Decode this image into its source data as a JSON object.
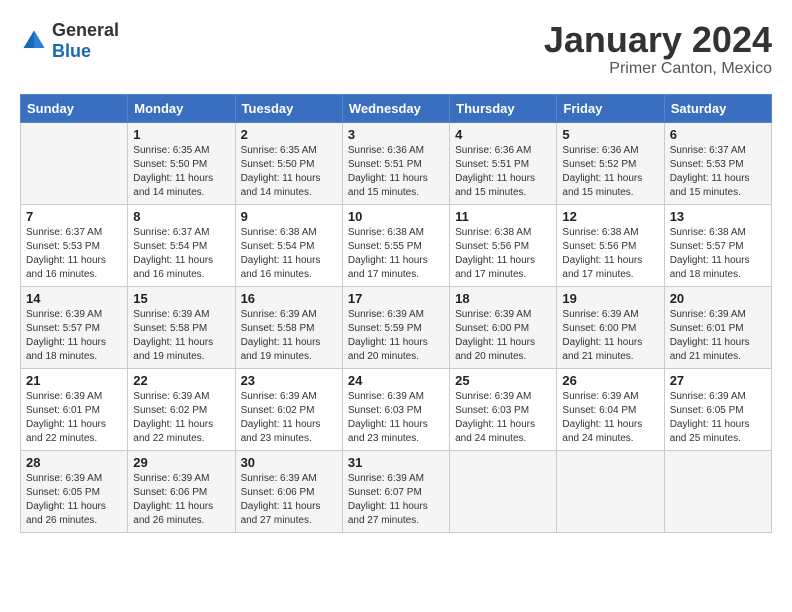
{
  "header": {
    "logo": {
      "general": "General",
      "blue": "Blue"
    },
    "title": "January 2024",
    "location": "Primer Canton, Mexico"
  },
  "calendar": {
    "days_of_week": [
      "Sunday",
      "Monday",
      "Tuesday",
      "Wednesday",
      "Thursday",
      "Friday",
      "Saturday"
    ],
    "weeks": [
      [
        {
          "day": "",
          "sunrise": "",
          "sunset": "",
          "daylight": ""
        },
        {
          "day": "1",
          "sunrise": "Sunrise: 6:35 AM",
          "sunset": "Sunset: 5:50 PM",
          "daylight": "Daylight: 11 hours and 14 minutes."
        },
        {
          "day": "2",
          "sunrise": "Sunrise: 6:35 AM",
          "sunset": "Sunset: 5:50 PM",
          "daylight": "Daylight: 11 hours and 14 minutes."
        },
        {
          "day": "3",
          "sunrise": "Sunrise: 6:36 AM",
          "sunset": "Sunset: 5:51 PM",
          "daylight": "Daylight: 11 hours and 15 minutes."
        },
        {
          "day": "4",
          "sunrise": "Sunrise: 6:36 AM",
          "sunset": "Sunset: 5:51 PM",
          "daylight": "Daylight: 11 hours and 15 minutes."
        },
        {
          "day": "5",
          "sunrise": "Sunrise: 6:36 AM",
          "sunset": "Sunset: 5:52 PM",
          "daylight": "Daylight: 11 hours and 15 minutes."
        },
        {
          "day": "6",
          "sunrise": "Sunrise: 6:37 AM",
          "sunset": "Sunset: 5:53 PM",
          "daylight": "Daylight: 11 hours and 15 minutes."
        }
      ],
      [
        {
          "day": "7",
          "sunrise": "Sunrise: 6:37 AM",
          "sunset": "Sunset: 5:53 PM",
          "daylight": "Daylight: 11 hours and 16 minutes."
        },
        {
          "day": "8",
          "sunrise": "Sunrise: 6:37 AM",
          "sunset": "Sunset: 5:54 PM",
          "daylight": "Daylight: 11 hours and 16 minutes."
        },
        {
          "day": "9",
          "sunrise": "Sunrise: 6:38 AM",
          "sunset": "Sunset: 5:54 PM",
          "daylight": "Daylight: 11 hours and 16 minutes."
        },
        {
          "day": "10",
          "sunrise": "Sunrise: 6:38 AM",
          "sunset": "Sunset: 5:55 PM",
          "daylight": "Daylight: 11 hours and 17 minutes."
        },
        {
          "day": "11",
          "sunrise": "Sunrise: 6:38 AM",
          "sunset": "Sunset: 5:56 PM",
          "daylight": "Daylight: 11 hours and 17 minutes."
        },
        {
          "day": "12",
          "sunrise": "Sunrise: 6:38 AM",
          "sunset": "Sunset: 5:56 PM",
          "daylight": "Daylight: 11 hours and 17 minutes."
        },
        {
          "day": "13",
          "sunrise": "Sunrise: 6:38 AM",
          "sunset": "Sunset: 5:57 PM",
          "daylight": "Daylight: 11 hours and 18 minutes."
        }
      ],
      [
        {
          "day": "14",
          "sunrise": "Sunrise: 6:39 AM",
          "sunset": "Sunset: 5:57 PM",
          "daylight": "Daylight: 11 hours and 18 minutes."
        },
        {
          "day": "15",
          "sunrise": "Sunrise: 6:39 AM",
          "sunset": "Sunset: 5:58 PM",
          "daylight": "Daylight: 11 hours and 19 minutes."
        },
        {
          "day": "16",
          "sunrise": "Sunrise: 6:39 AM",
          "sunset": "Sunset: 5:58 PM",
          "daylight": "Daylight: 11 hours and 19 minutes."
        },
        {
          "day": "17",
          "sunrise": "Sunrise: 6:39 AM",
          "sunset": "Sunset: 5:59 PM",
          "daylight": "Daylight: 11 hours and 20 minutes."
        },
        {
          "day": "18",
          "sunrise": "Sunrise: 6:39 AM",
          "sunset": "Sunset: 6:00 PM",
          "daylight": "Daylight: 11 hours and 20 minutes."
        },
        {
          "day": "19",
          "sunrise": "Sunrise: 6:39 AM",
          "sunset": "Sunset: 6:00 PM",
          "daylight": "Daylight: 11 hours and 21 minutes."
        },
        {
          "day": "20",
          "sunrise": "Sunrise: 6:39 AM",
          "sunset": "Sunset: 6:01 PM",
          "daylight": "Daylight: 11 hours and 21 minutes."
        }
      ],
      [
        {
          "day": "21",
          "sunrise": "Sunrise: 6:39 AM",
          "sunset": "Sunset: 6:01 PM",
          "daylight": "Daylight: 11 hours and 22 minutes."
        },
        {
          "day": "22",
          "sunrise": "Sunrise: 6:39 AM",
          "sunset": "Sunset: 6:02 PM",
          "daylight": "Daylight: 11 hours and 22 minutes."
        },
        {
          "day": "23",
          "sunrise": "Sunrise: 6:39 AM",
          "sunset": "Sunset: 6:02 PM",
          "daylight": "Daylight: 11 hours and 23 minutes."
        },
        {
          "day": "24",
          "sunrise": "Sunrise: 6:39 AM",
          "sunset": "Sunset: 6:03 PM",
          "daylight": "Daylight: 11 hours and 23 minutes."
        },
        {
          "day": "25",
          "sunrise": "Sunrise: 6:39 AM",
          "sunset": "Sunset: 6:03 PM",
          "daylight": "Daylight: 11 hours and 24 minutes."
        },
        {
          "day": "26",
          "sunrise": "Sunrise: 6:39 AM",
          "sunset": "Sunset: 6:04 PM",
          "daylight": "Daylight: 11 hours and 24 minutes."
        },
        {
          "day": "27",
          "sunrise": "Sunrise: 6:39 AM",
          "sunset": "Sunset: 6:05 PM",
          "daylight": "Daylight: 11 hours and 25 minutes."
        }
      ],
      [
        {
          "day": "28",
          "sunrise": "Sunrise: 6:39 AM",
          "sunset": "Sunset: 6:05 PM",
          "daylight": "Daylight: 11 hours and 26 minutes."
        },
        {
          "day": "29",
          "sunrise": "Sunrise: 6:39 AM",
          "sunset": "Sunset: 6:06 PM",
          "daylight": "Daylight: 11 hours and 26 minutes."
        },
        {
          "day": "30",
          "sunrise": "Sunrise: 6:39 AM",
          "sunset": "Sunset: 6:06 PM",
          "daylight": "Daylight: 11 hours and 27 minutes."
        },
        {
          "day": "31",
          "sunrise": "Sunrise: 6:39 AM",
          "sunset": "Sunset: 6:07 PM",
          "daylight": "Daylight: 11 hours and 27 minutes."
        },
        {
          "day": "",
          "sunrise": "",
          "sunset": "",
          "daylight": ""
        },
        {
          "day": "",
          "sunrise": "",
          "sunset": "",
          "daylight": ""
        },
        {
          "day": "",
          "sunrise": "",
          "sunset": "",
          "daylight": ""
        }
      ]
    ]
  }
}
